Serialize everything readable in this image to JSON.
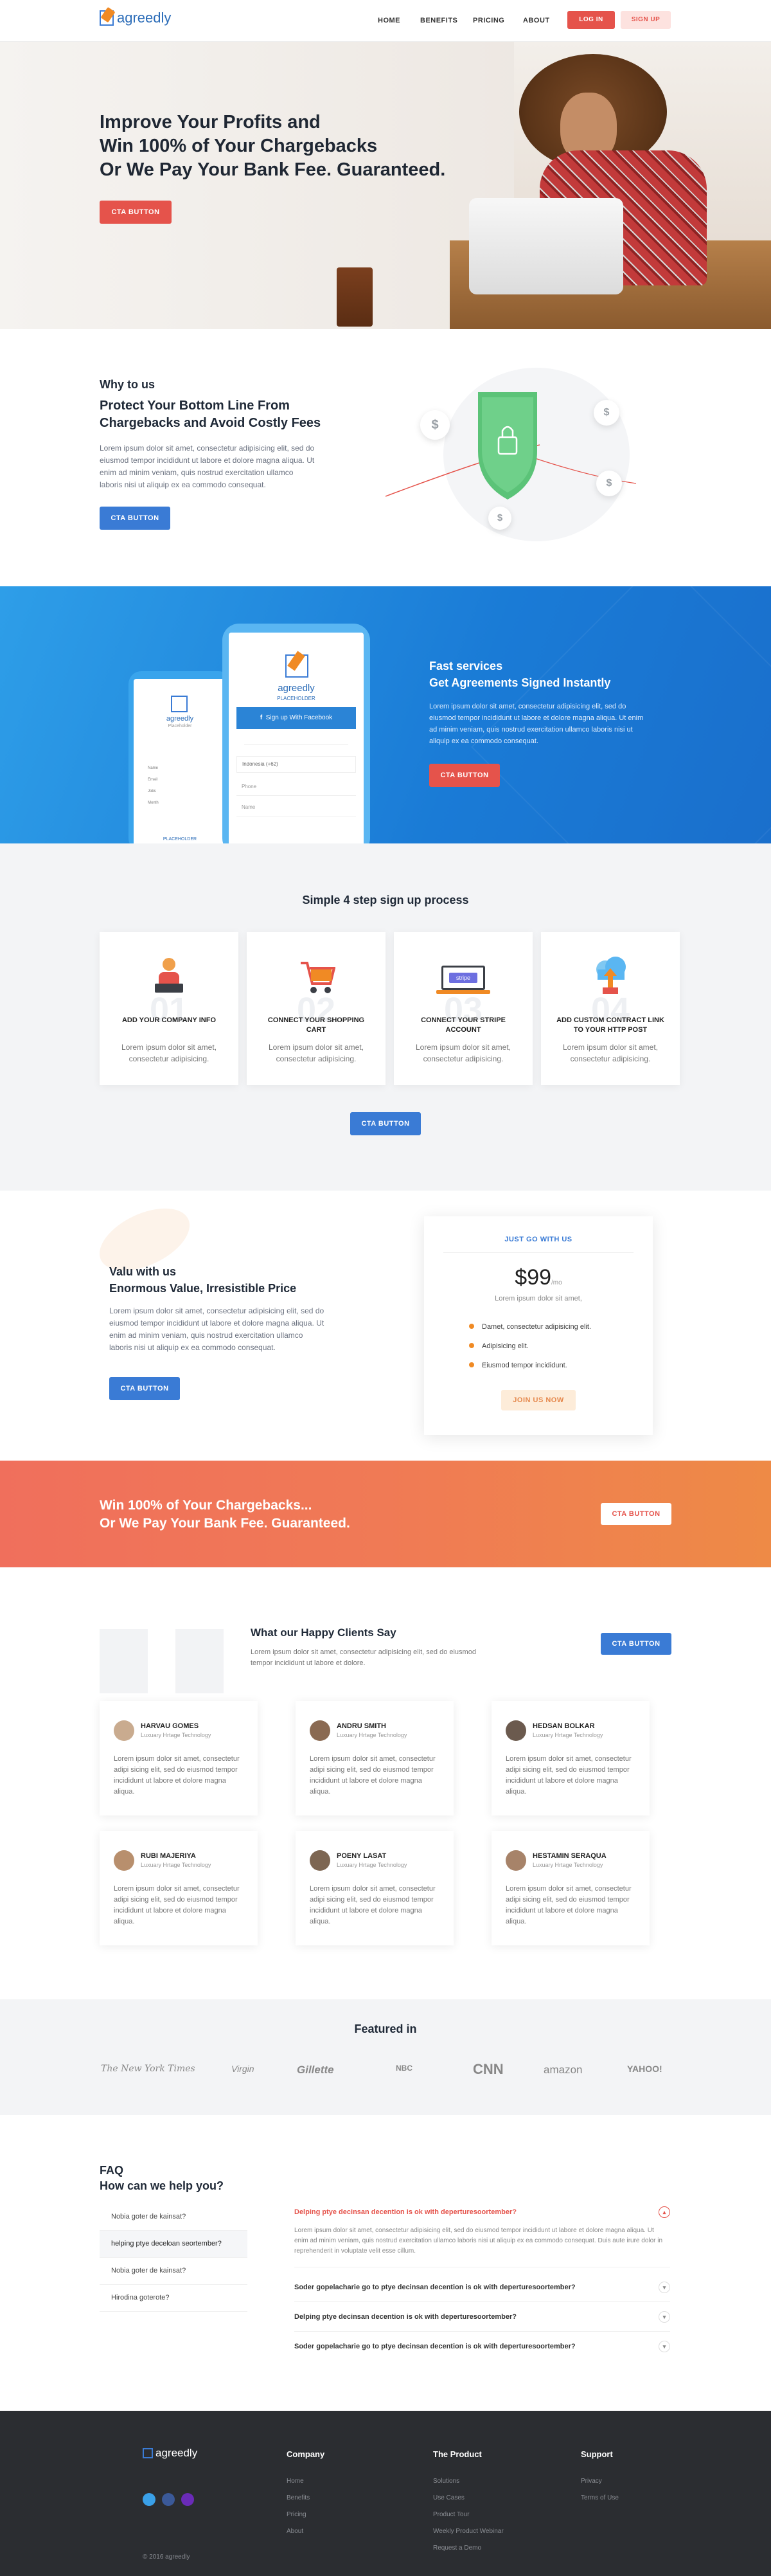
{
  "brand": {
    "name": "agreedly"
  },
  "nav": {
    "links": [
      "HOME",
      "BENEFITS",
      "PRICING",
      "ABOUT"
    ],
    "login": "LOG IN",
    "signup": "SIGN UP"
  },
  "hero": {
    "title_l1": "Improve Your Profits and",
    "title_l2": "Win 100% of Your Chargebacks",
    "title_l3": "Or We Pay Your Bank Fee. Guaranteed.",
    "cta": "CTA BUTTON"
  },
  "why": {
    "eyebrow": "Why to us",
    "title_l1": "Protect Your Bottom Line From",
    "title_l2": "Chargebacks and Avoid Costly Fees",
    "text": "Lorem ipsum dolor sit amet, consectetur adipisicing elit, sed do eiusmod tempor incididunt ut labore et dolore magna aliqua. Ut enim ad minim veniam, quis nostrud exercitation ullamco laboris nisi ut aliquip ex ea commodo consequat.",
    "cta": "CTA BUTTON",
    "dollar": "$"
  },
  "fast": {
    "eyebrow": "Fast services",
    "title": "Get Agreements Signed Instantly",
    "text": "Lorem ipsum dolor sit amet, consectetur adipisicing elit, sed do eiusmod tempor incididunt ut labore et dolore magna aliqua. Ut enim ad minim veniam, quis nostrud exercitation ullamco laboris nisi ut aliquip ex ea commodo consequat.",
    "cta": "CTA BUTTON",
    "phone_brand": "agreedly",
    "phone_placeholder": "PLACEHOLDER",
    "phone_sub": "Placeholder",
    "fb_button": "Sign up With Facebook",
    "phone_field1": "Indonesia (+62)",
    "phone_field2": "Phone",
    "phone_field3": "Name",
    "small_items": [
      "Name",
      "Email",
      "Jobs",
      "Month"
    ]
  },
  "steps": {
    "title": "Simple 4 step sign up process",
    "items": [
      {
        "num": "01",
        "title": "ADD YOUR COMPANY INFO",
        "text": "Lorem ipsum dolor sit amet, consectetur adipisicing."
      },
      {
        "num": "02",
        "title": "CONNECT YOUR SHOPPING CART",
        "text": "Lorem ipsum dolor sit amet, consectetur adipisicing."
      },
      {
        "num": "03",
        "title": "CONNECT YOUR STRIPE ACCOUNT",
        "text": "Lorem ipsum dolor sit amet, consectetur adipisicing."
      },
      {
        "num": "04",
        "title": "ADD CUSTOM CONTRACT LINK TO YOUR HTTP POST",
        "text": "Lorem ipsum dolor sit amet, consectetur adipisicing."
      }
    ],
    "stripe": "stripe",
    "cta": "CTA BUTTON"
  },
  "pricing": {
    "eyebrow": "Valu with us",
    "title": "Enormous Value, Irresistible Price",
    "text": "Lorem ipsum dolor sit amet, consectetur adipisicing elit, sed do eiusmod tempor incididunt ut labore et dolore magna aliqua. Ut enim ad minim veniam, quis nostrud exercitation ullamco laboris nisi ut aliquip ex ea commodo consequat.",
    "cta": "CTA BUTTON",
    "card_label": "JUST GO WITH US",
    "price": "$99",
    "per": "/mo",
    "card_sub": "Lorem ipsum dolor sit amet,",
    "features": [
      "Damet, consectetur adipisicing elit.",
      "Adipisicing elit.",
      "Eiusmod tempor incididunt."
    ],
    "join": "JOIN US NOW"
  },
  "win": {
    "line1": "Win 100% of Your Chargebacks...",
    "line2": "Or We Pay Your Bank Fee. Guaranteed.",
    "cta": "CTA BUTTON"
  },
  "clients": {
    "title": "What our Happy Clients Say",
    "text": "Lorem ipsum dolor sit amet, consectetur adipisicing elit, sed do eiusmod tempor incididunt ut labore et dolore.",
    "cta": "CTA BUTTON",
    "items": [
      {
        "name": "HARVAU GOMES",
        "role": "Luxuary Hrtage Technology",
        "text": "Lorem ipsum dolor sit amet, consectetur adipi sicing elit, sed do eiusmod tempor incididunt ut labore et dolore magna aliqua."
      },
      {
        "name": "ANDRU SMITH",
        "role": "Luxuary Hrtage Technology",
        "text": "Lorem ipsum dolor sit amet, consectetur adipi sicing elit, sed do eiusmod tempor incididunt ut labore et dolore magna aliqua."
      },
      {
        "name": "HEDSAN BOLKAR",
        "role": "Luxuary Hrtage Technology",
        "text": "Lorem ipsum dolor sit amet, consectetur adipi sicing elit, sed do eiusmod tempor incididunt ut labore et dolore magna aliqua."
      },
      {
        "name": "RUBI MAJERIYA",
        "role": "Luxuary Hrtage Technology",
        "text": "Lorem ipsum dolor sit amet, consectetur adipi sicing elit, sed do eiusmod tempor incididunt ut labore et dolore magna aliqua."
      },
      {
        "name": "POENY LASAT",
        "role": "Luxuary Hrtage Technology",
        "text": "Lorem ipsum dolor sit amet, consectetur adipi sicing elit, sed do eiusmod tempor incididunt ut labore et dolore magna aliqua."
      },
      {
        "name": "HESTAMIN SERAQUA",
        "role": "Luxuary Hrtage Technology",
        "text": "Lorem ipsum dolor sit amet, consectetur adipi sicing elit, sed do eiusmod tempor incididunt ut labore et dolore magna aliqua."
      }
    ]
  },
  "featured": {
    "title": "Featured in",
    "logos": [
      "The New York Times",
      "Virgin",
      "Gillette",
      "NBC",
      "CNN",
      "amazon",
      "YAHOO!"
    ]
  },
  "faq": {
    "title_l1": "FAQ",
    "title_l2": "How can we help you?",
    "questions": [
      "Nobia goter de kainsat?",
      "helping ptye deceloan seortember?",
      "Nobia goter de kainsat?",
      "Hirodina goterote?"
    ],
    "open_q": "Delping ptye decinsan decention is ok with deperturesoortember?",
    "open_a": "Lorem ipsum dolor sit amet, consectetur adipisicing elit, sed do eiusmod tempor incididunt ut labore et dolore magna aliqua. Ut enim ad minim veniam, quis nostrud exercitation ullamco laboris nisi ut aliquip ex ea commodo consequat. Duis aute irure dolor in reprehenderit in voluptate velit esse cillum.",
    "others": [
      "Soder gopelacharie go to ptye decinsan decention is ok with deperturesoortember?",
      "Delping ptye decinsan decention is ok with deperturesoortember?",
      "Soder gopelacharie go to ptye decinsan decention is ok with deperturesoortember?"
    ]
  },
  "footer": {
    "company_h": "Company",
    "company": [
      "Home",
      "Benefits",
      "Pricing",
      "About"
    ],
    "product_h": "The Product",
    "product": [
      "Solutions",
      "Use Cases",
      "Product Tour",
      "Weekly Product Webinar",
      "Request a Demo"
    ],
    "support_h": "Support",
    "support": [
      "Privacy",
      "Terms of Use"
    ],
    "copyright": "© 2016 agreedly"
  }
}
